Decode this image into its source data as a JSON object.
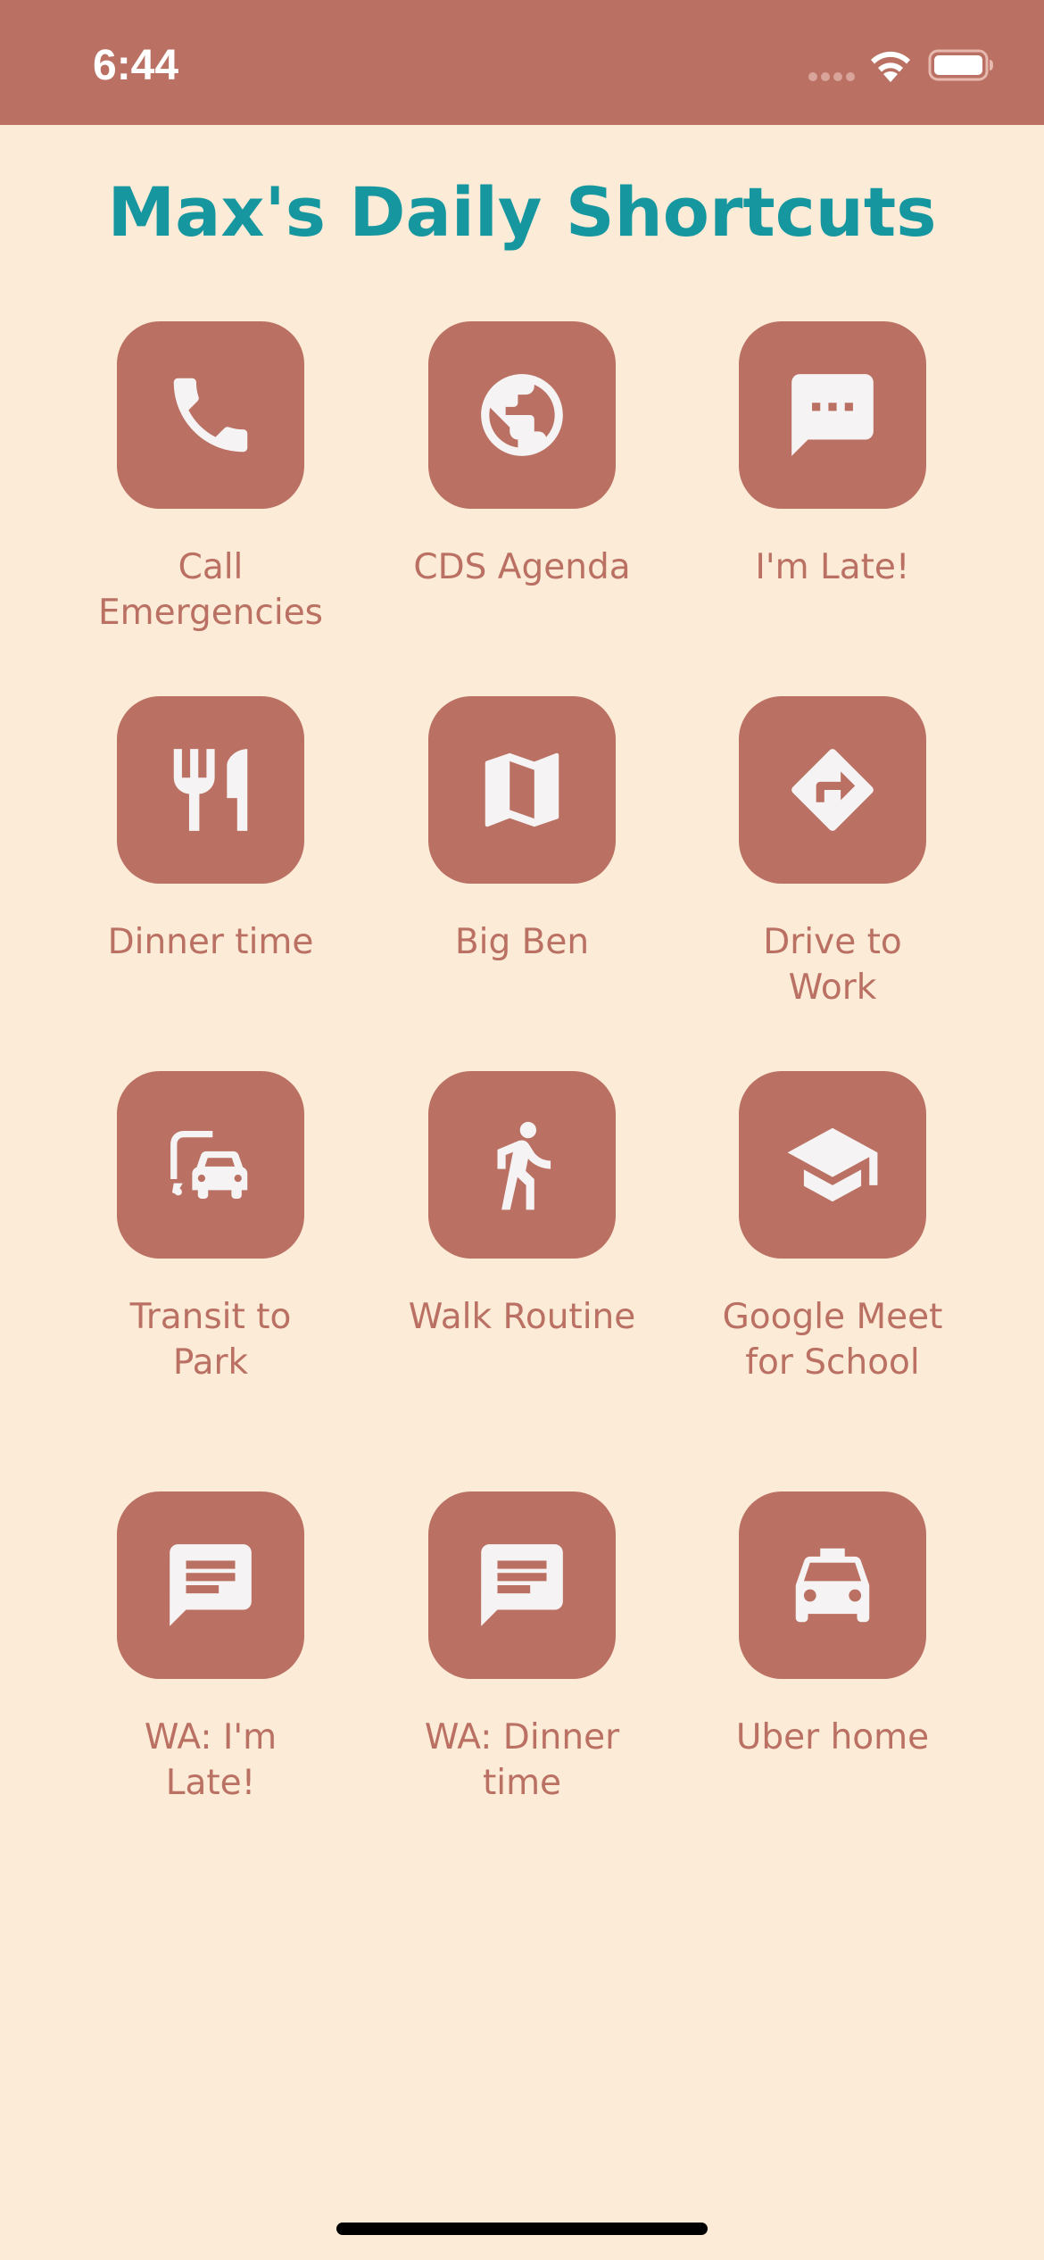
{
  "status_bar": {
    "time": "6:44"
  },
  "page": {
    "title": "Max's Daily Shortcuts"
  },
  "colors": {
    "background": "#FBEBD7",
    "accent": "#BA7062",
    "title": "#16979F",
    "icon": "#F5F3F3"
  },
  "shortcuts": [
    {
      "label": "Call Emergencies",
      "icon": "phone-icon"
    },
    {
      "label": "CDS Agenda",
      "icon": "globe-icon"
    },
    {
      "label": "I'm Late!",
      "icon": "chat-bubble-icon"
    },
    {
      "label": "Dinner time",
      "icon": "restaurant-icon"
    },
    {
      "label": "Big Ben",
      "icon": "map-icon"
    },
    {
      "label": "Drive to Work",
      "icon": "directions-icon"
    },
    {
      "label": "Transit to Park",
      "icon": "transit-car-icon"
    },
    {
      "label": "Walk Routine",
      "icon": "walking-icon"
    },
    {
      "label": "Google Meet for School",
      "icon": "school-icon"
    },
    {
      "label": "WA: I'm Late!",
      "icon": "message-icon"
    },
    {
      "label": "WA: Dinner time",
      "icon": "message-icon"
    },
    {
      "label": "Uber home",
      "icon": "taxi-icon"
    }
  ]
}
